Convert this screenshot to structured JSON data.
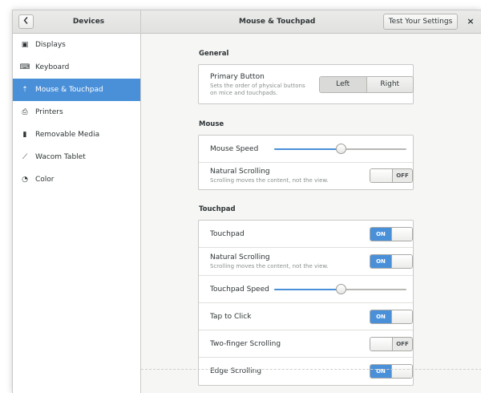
{
  "header": {
    "back_icon": "chevron-left-icon",
    "left_title": "Devices",
    "main_title": "Mouse & Touchpad",
    "test_button": "Test Your Settings",
    "close_label": "×"
  },
  "sidebar": {
    "items": [
      {
        "label": "Displays",
        "icon": "display-icon",
        "glyph": "▣",
        "active": false
      },
      {
        "label": "Keyboard",
        "icon": "keyboard-icon",
        "glyph": "⌨",
        "active": false
      },
      {
        "label": "Mouse & Touchpad",
        "icon": "mouse-icon",
        "glyph": "⇡",
        "active": true
      },
      {
        "label": "Printers",
        "icon": "printer-icon",
        "glyph": "⎙",
        "active": false
      },
      {
        "label": "Removable Media",
        "icon": "usb-icon",
        "glyph": "▮",
        "active": false
      },
      {
        "label": "Wacom Tablet",
        "icon": "tablet-icon",
        "glyph": "⟋",
        "active": false
      },
      {
        "label": "Color",
        "icon": "color-icon",
        "glyph": "◔",
        "active": false
      }
    ]
  },
  "general": {
    "title": "General",
    "primary_button": {
      "label": "Primary Button",
      "description_line1": "Sets the order of physical buttons",
      "description_line2": "on mice and touchpads.",
      "options": [
        "Left",
        "Right"
      ],
      "selected": "Left"
    }
  },
  "mouse": {
    "title": "Mouse",
    "speed_label": "Mouse Speed",
    "speed_value": 0.5,
    "natural_scrolling": {
      "label": "Natural Scrolling",
      "description": "Scrolling moves the content, not the view.",
      "state": "OFF"
    }
  },
  "touchpad": {
    "title": "Touchpad",
    "touchpad_toggle": {
      "label": "Touchpad",
      "state": "ON"
    },
    "natural_scrolling": {
      "label": "Natural Scrolling",
      "description": "Scrolling moves the content, not the view.",
      "state": "ON"
    },
    "speed_label": "Touchpad Speed",
    "speed_value": 0.5,
    "tap_to_click": {
      "label": "Tap to Click",
      "state": "ON"
    },
    "two_finger": {
      "label": "Two-finger Scrolling",
      "state": "OFF"
    },
    "edge_scrolling": {
      "label": "Edge Scrolling",
      "state": "ON"
    }
  },
  "colors": {
    "accent": "#4a90d9"
  }
}
